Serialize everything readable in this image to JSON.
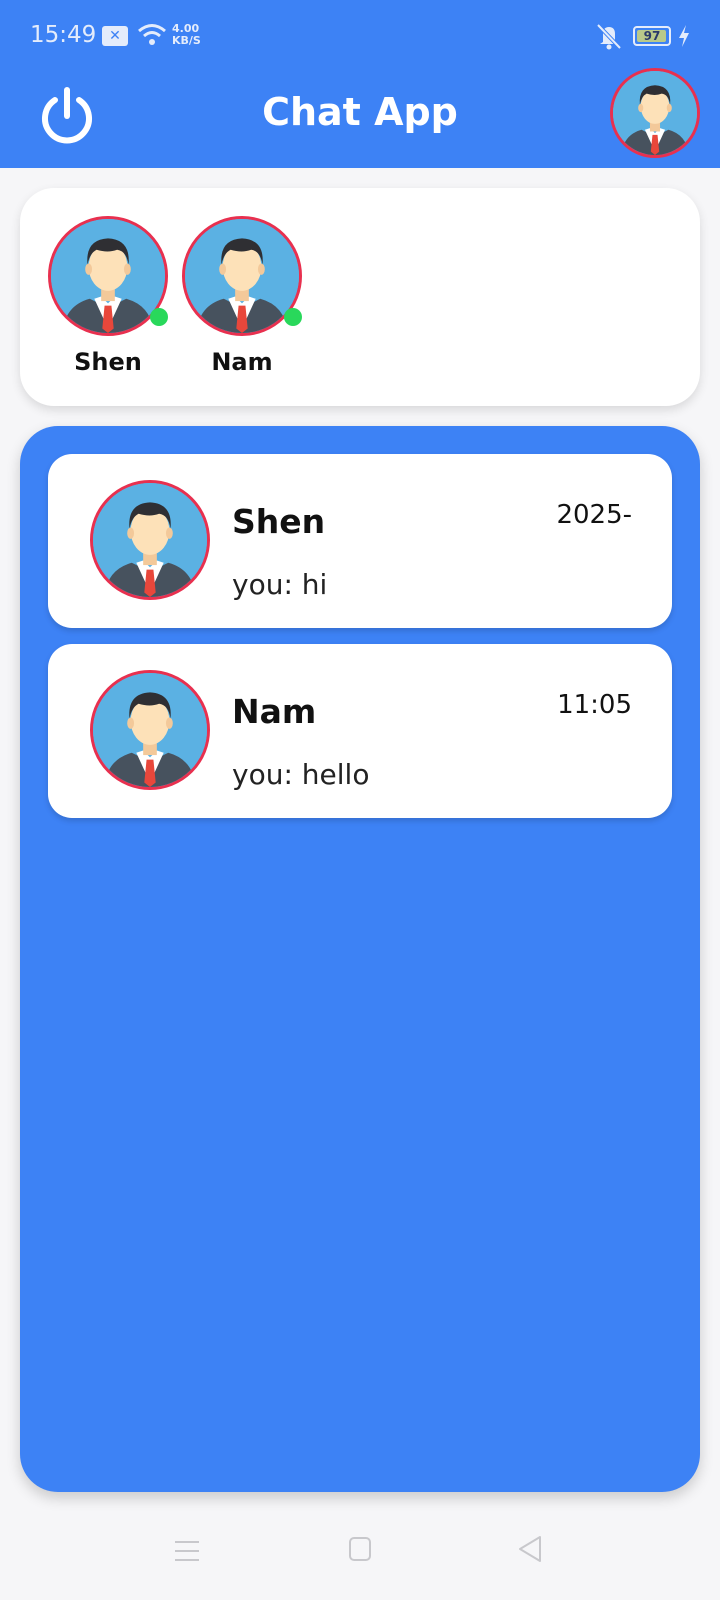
{
  "theme": {
    "accent": "#3d82f5",
    "avatar_ring": "#e8304f",
    "online": "#29d85b"
  },
  "status_bar": {
    "time": "15:49",
    "speed_value": "4.00",
    "speed_unit": "KB/S",
    "battery_level": 97,
    "battery_label": "97",
    "icons": [
      "notification-icon",
      "wifi-icon",
      "mute-icon",
      "battery-icon",
      "charging-icon"
    ]
  },
  "header": {
    "title": "Chat App",
    "left_icon": "power-icon",
    "right_icon": "profile-avatar"
  },
  "online_users": [
    {
      "name": "Shen",
      "online": true
    },
    {
      "name": "Nam",
      "online": true
    }
  ],
  "chats": [
    {
      "name": "Shen",
      "time": "2025-",
      "preview": "you: hi"
    },
    {
      "name": "Nam",
      "time": "11:05",
      "preview": "you: hello"
    }
  ],
  "nav_bar": {
    "icons": [
      "menu-icon",
      "home-icon",
      "back-icon"
    ]
  }
}
